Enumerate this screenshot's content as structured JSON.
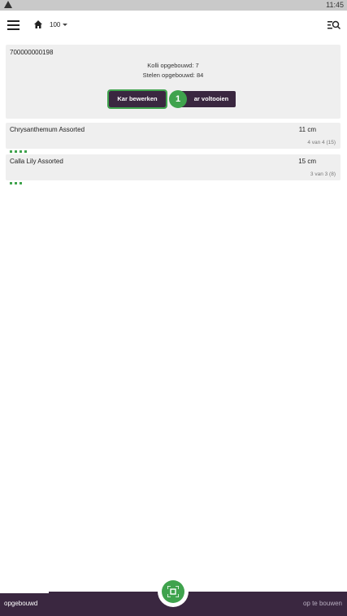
{
  "statusbar": {
    "time": "11:45"
  },
  "appbar": {
    "location": "100"
  },
  "cart": {
    "id": "700000000198",
    "kolli": "Kolli opgebouwd: 7",
    "stelen": "Stelen opgebouwd: 84",
    "edit_label": "Kar bewerken",
    "complete_label": "ar voltooien",
    "step_number": "1"
  },
  "items": [
    {
      "name": "Chrysanthemum Assorted",
      "size": "11 cm",
      "count": "4 van 4 (15)",
      "dots": 4
    },
    {
      "name": "Calla Lily Assorted",
      "size": "15 cm",
      "count": "3 van 3 (8)",
      "dots": 3
    }
  ],
  "bottom": {
    "left_tab": "opgebouwd",
    "right_tab": "op te bouwen"
  },
  "colors": {
    "accent": "#3fa34d",
    "brand": "#3a2740"
  }
}
